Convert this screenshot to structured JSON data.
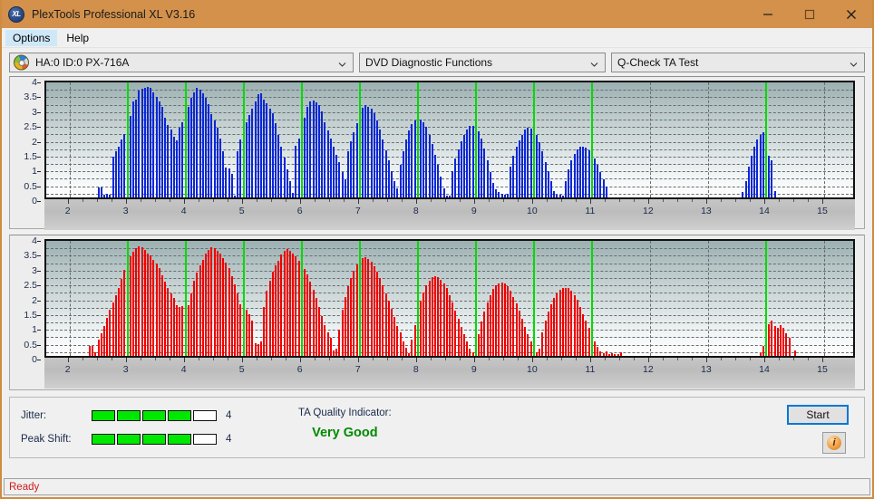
{
  "window": {
    "title": "PlexTools Professional XL V3.16",
    "app_icon": "xl-disc-icon",
    "minimize_label": "Minimize",
    "maximize_label": "Maximize",
    "close_label": "Close",
    "titlebar_color": "#d3914b"
  },
  "menu": {
    "items": [
      {
        "label": "Options"
      },
      {
        "label": "Help"
      }
    ]
  },
  "selectors": {
    "drive": {
      "value": "HA:0 ID:0  PX-716A",
      "icon": "disc-icon"
    },
    "function": {
      "value": "DVD Diagnostic Functions"
    },
    "test": {
      "value": "Q-Check TA Test"
    }
  },
  "status": {
    "text": "Ready",
    "color": "#d11a1a"
  },
  "metrics": {
    "jitter": {
      "label": "Jitter:",
      "value": "4",
      "filled": 4,
      "total": 5
    },
    "peak_shift": {
      "label": "Peak Shift:",
      "value": "4",
      "filled": 4,
      "total": 5
    },
    "ta_quality": {
      "label": "TA Quality Indicator:",
      "value": "Very Good",
      "color": "#008a00"
    }
  },
  "buttons": {
    "start": {
      "label": "Start"
    },
    "info": {
      "label": "i",
      "icon": "info-icon"
    }
  },
  "chart_data": [
    {
      "type": "bar",
      "id": "jitter-chart",
      "title": "",
      "xlabel": "",
      "ylabel": "",
      "series_name": "Jitter",
      "color": "#0b27d6",
      "xlim": [
        1.6,
        15.5
      ],
      "ylim": [
        0,
        4
      ],
      "yticks": [
        0,
        0.5,
        1,
        1.5,
        2,
        2.5,
        3,
        3.5,
        4
      ],
      "ytick_labels": [
        "0",
        "0.5",
        "1",
        "1.5",
        "2",
        "2.5",
        "3",
        "3.5",
        "4"
      ],
      "xticks": [
        2,
        3,
        4,
        5,
        6,
        7,
        8,
        9,
        10,
        11,
        12,
        13,
        14,
        15
      ],
      "xtick_labels": [
        "2",
        "3",
        "4",
        "5",
        "6",
        "7",
        "8",
        "9",
        "10",
        "11",
        "12",
        "13",
        "14",
        "15"
      ],
      "grid": true,
      "marker_lines": [
        3,
        4,
        5,
        6,
        7,
        8,
        9,
        10,
        11,
        14
      ],
      "x": [
        2.5,
        2.55,
        2.6,
        2.65,
        2.7,
        2.75,
        2.8,
        2.85,
        2.9,
        2.95,
        3.0,
        3.05,
        3.1,
        3.15,
        3.2,
        3.25,
        3.3,
        3.35,
        3.4,
        3.45,
        3.5,
        3.55,
        3.6,
        3.65,
        3.7,
        3.75,
        3.8,
        3.85,
        3.9,
        3.95,
        4.0,
        4.05,
        4.1,
        4.15,
        4.2,
        4.25,
        4.3,
        4.35,
        4.4,
        4.45,
        4.5,
        4.55,
        4.6,
        4.65,
        4.7,
        4.75,
        4.8,
        4.85,
        4.9,
        4.95,
        5.0,
        5.05,
        5.1,
        5.15,
        5.2,
        5.25,
        5.3,
        5.35,
        5.4,
        5.45,
        5.5,
        5.55,
        5.6,
        5.65,
        5.7,
        5.75,
        5.8,
        5.85,
        5.9,
        5.95,
        6.0,
        6.05,
        6.1,
        6.15,
        6.2,
        6.25,
        6.3,
        6.35,
        6.4,
        6.45,
        6.5,
        6.55,
        6.6,
        6.65,
        6.7,
        6.75,
        6.8,
        6.85,
        6.9,
        6.95,
        7.0,
        7.05,
        7.1,
        7.15,
        7.2,
        7.25,
        7.3,
        7.35,
        7.4,
        7.45,
        7.5,
        7.55,
        7.6,
        7.65,
        7.7,
        7.75,
        7.8,
        7.85,
        7.9,
        7.95,
        8.0,
        8.05,
        8.1,
        8.15,
        8.2,
        8.25,
        8.3,
        8.35,
        8.4,
        8.45,
        8.5,
        8.55,
        8.6,
        8.65,
        8.7,
        8.75,
        8.8,
        8.85,
        8.9,
        8.95,
        9.0,
        9.05,
        9.1,
        9.15,
        9.2,
        9.25,
        9.3,
        9.35,
        9.4,
        9.45,
        9.5,
        9.55,
        9.6,
        9.65,
        9.7,
        9.75,
        9.8,
        9.85,
        9.9,
        9.95,
        10.0,
        10.05,
        10.1,
        10.15,
        10.2,
        10.25,
        10.3,
        10.35,
        10.4,
        10.45,
        10.5,
        10.55,
        10.6,
        10.65,
        10.7,
        10.75,
        10.8,
        10.85,
        10.9,
        10.95,
        11.0,
        11.05,
        11.1,
        11.15,
        11.2,
        11.25,
        13.6,
        13.65,
        13.7,
        13.75,
        13.8,
        13.85,
        13.9,
        13.95,
        14.0,
        14.05,
        14.1,
        14.15
      ],
      "values": [
        0.33,
        0.33,
        0.1,
        0.12,
        0.1,
        1.38,
        1.55,
        1.7,
        1.95,
        2.15,
        2.4,
        2.75,
        3.25,
        3.3,
        3.6,
        3.65,
        3.7,
        3.72,
        3.7,
        3.55,
        3.4,
        3.25,
        3.05,
        2.7,
        2.45,
        2.3,
        2.05,
        1.92,
        2.35,
        2.55,
        2.7,
        3.05,
        3.35,
        3.55,
        3.68,
        3.62,
        3.5,
        3.35,
        3.15,
        2.8,
        2.6,
        2.35,
        2.0,
        1.55,
        1.0,
        0.98,
        0.8,
        0.05,
        1.55,
        1.95,
        2.25,
        2.55,
        2.78,
        3.0,
        3.25,
        3.48,
        3.52,
        3.3,
        3.18,
        3.0,
        2.85,
        2.5,
        2.1,
        1.7,
        1.35,
        0.95,
        0.55,
        0.15,
        1.75,
        2.0,
        2.35,
        2.7,
        3.05,
        3.25,
        3.28,
        3.22,
        3.1,
        2.9,
        2.55,
        2.25,
        2.0,
        1.72,
        1.45,
        1.2,
        0.85,
        0.6,
        1.55,
        1.9,
        2.2,
        2.5,
        2.8,
        3.02,
        3.1,
        3.05,
        3.0,
        2.85,
        2.6,
        2.3,
        1.95,
        1.6,
        1.25,
        0.9,
        0.55,
        0.3,
        1.1,
        1.55,
        1.95,
        2.25,
        2.48,
        2.6,
        2.65,
        2.62,
        2.55,
        2.38,
        2.12,
        1.8,
        1.45,
        1.1,
        0.7,
        0.3,
        0.05,
        0.05,
        0.9,
        1.3,
        1.62,
        1.9,
        2.12,
        2.3,
        2.4,
        2.42,
        2.38,
        2.22,
        2.0,
        1.65,
        1.25,
        0.85,
        0.5,
        0.28,
        0.18,
        0.12,
        0.08,
        0.12,
        1.05,
        1.4,
        1.7,
        1.92,
        2.12,
        2.28,
        2.35,
        2.32,
        2.28,
        2.1,
        1.85,
        1.55,
        1.2,
        0.9,
        0.55,
        0.22,
        0.08,
        0.08,
        0.06,
        0.55,
        0.95,
        1.25,
        1.48,
        1.62,
        1.7,
        1.72,
        1.68,
        1.6,
        1.48,
        1.32,
        1.1,
        0.85,
        0.6,
        0.38,
        0.18,
        0.55,
        1.05,
        1.4,
        1.7,
        1.95,
        2.12,
        2.2,
        2.18,
        1.4,
        1.25,
        0.2
      ]
    },
    {
      "type": "bar",
      "id": "peak-shift-chart",
      "title": "",
      "xlabel": "",
      "ylabel": "",
      "series_name": "Peak Shift",
      "color": "#ef0000",
      "xlim": [
        1.6,
        15.5
      ],
      "ylim": [
        0,
        4
      ],
      "yticks": [
        0,
        0.5,
        1,
        1.5,
        2,
        2.5,
        3,
        3.5,
        4
      ],
      "ytick_labels": [
        "0",
        "0.5",
        "1",
        "1.5",
        "2",
        "2.5",
        "3",
        "3.5",
        "4"
      ],
      "xticks": [
        2,
        3,
        4,
        5,
        6,
        7,
        8,
        9,
        10,
        11,
        12,
        13,
        14,
        15
      ],
      "xtick_labels": [
        "2",
        "3",
        "4",
        "5",
        "6",
        "7",
        "8",
        "9",
        "10",
        "11",
        "12",
        "13",
        "14",
        "15"
      ],
      "grid": true,
      "marker_lines": [
        3,
        4,
        5,
        6,
        7,
        8,
        9,
        10,
        11,
        14
      ],
      "x": [
        2.35,
        2.4,
        2.45,
        2.5,
        2.55,
        2.6,
        2.65,
        2.7,
        2.75,
        2.8,
        2.85,
        2.9,
        2.95,
        3.0,
        3.05,
        3.1,
        3.15,
        3.2,
        3.25,
        3.3,
        3.35,
        3.4,
        3.45,
        3.5,
        3.55,
        3.6,
        3.65,
        3.7,
        3.75,
        3.8,
        3.85,
        3.9,
        3.95,
        4.0,
        4.05,
        4.1,
        4.15,
        4.2,
        4.25,
        4.3,
        4.35,
        4.4,
        4.45,
        4.5,
        4.55,
        4.6,
        4.65,
        4.7,
        4.75,
        4.8,
        4.85,
        4.9,
        4.95,
        5.0,
        5.05,
        5.1,
        5.15,
        5.2,
        5.25,
        5.3,
        5.35,
        5.4,
        5.45,
        5.5,
        5.55,
        5.6,
        5.65,
        5.7,
        5.75,
        5.8,
        5.85,
        5.9,
        5.95,
        6.0,
        6.05,
        6.1,
        6.15,
        6.2,
        6.25,
        6.3,
        6.35,
        6.4,
        6.45,
        6.5,
        6.55,
        6.6,
        6.65,
        6.7,
        6.75,
        6.8,
        6.85,
        6.9,
        6.95,
        7.0,
        7.05,
        7.1,
        7.15,
        7.2,
        7.25,
        7.3,
        7.35,
        7.4,
        7.45,
        7.5,
        7.55,
        7.6,
        7.65,
        7.7,
        7.75,
        7.8,
        7.85,
        7.9,
        7.95,
        8.0,
        8.05,
        8.1,
        8.15,
        8.2,
        8.25,
        8.3,
        8.35,
        8.4,
        8.45,
        8.5,
        8.55,
        8.6,
        8.65,
        8.7,
        8.75,
        8.8,
        8.85,
        8.9,
        8.95,
        9.0,
        9.05,
        9.1,
        9.15,
        9.2,
        9.25,
        9.3,
        9.35,
        9.4,
        9.45,
        9.5,
        9.55,
        9.6,
        9.65,
        9.7,
        9.75,
        9.8,
        9.85,
        9.9,
        9.95,
        10.0,
        10.05,
        10.1,
        10.15,
        10.2,
        10.25,
        10.3,
        10.35,
        10.4,
        10.45,
        10.5,
        10.55,
        10.6,
        10.65,
        10.7,
        10.75,
        10.8,
        10.85,
        10.9,
        10.95,
        11.0,
        11.05,
        11.1,
        11.15,
        11.2,
        11.25,
        11.3,
        11.35,
        11.4,
        11.45,
        11.5,
        13.9,
        13.95,
        14.0,
        14.05,
        14.1,
        14.15,
        14.2,
        14.25,
        14.3,
        14.35,
        14.4,
        14.5
      ],
      "values": [
        0.35,
        0.35,
        0.12,
        0.55,
        0.75,
        1.0,
        1.28,
        1.55,
        1.8,
        2.05,
        2.3,
        2.6,
        2.9,
        3.15,
        3.35,
        3.5,
        3.62,
        3.68,
        3.65,
        3.58,
        3.45,
        3.38,
        3.25,
        3.12,
        2.95,
        2.72,
        2.5,
        2.3,
        2.12,
        1.95,
        1.7,
        1.65,
        1.68,
        1.7,
        1.72,
        2.1,
        2.55,
        2.8,
        3.05,
        3.25,
        3.45,
        3.58,
        3.65,
        3.62,
        3.55,
        3.45,
        3.3,
        3.15,
        2.95,
        2.7,
        2.4,
        2.1,
        1.75,
        1.65,
        1.55,
        1.42,
        1.18,
        0.42,
        0.4,
        0.5,
        1.65,
        2.2,
        2.55,
        2.85,
        3.05,
        3.22,
        3.42,
        3.55,
        3.6,
        3.55,
        3.45,
        3.35,
        3.22,
        3.08,
        2.92,
        2.75,
        2.5,
        2.22,
        1.95,
        1.65,
        1.35,
        1.05,
        0.8,
        0.6,
        0.18,
        0.25,
        0.9,
        1.55,
        2.0,
        2.35,
        2.62,
        2.88,
        3.08,
        3.22,
        3.3,
        3.32,
        3.28,
        3.18,
        3.02,
        2.85,
        2.62,
        2.38,
        2.12,
        1.85,
        1.58,
        1.3,
        1.02,
        0.78,
        0.5,
        0.28,
        0.1,
        0.55,
        1.05,
        1.5,
        1.85,
        2.15,
        2.38,
        2.55,
        2.65,
        2.68,
        2.65,
        2.58,
        2.45,
        2.28,
        2.05,
        1.8,
        1.52,
        1.25,
        0.98,
        0.72,
        0.48,
        0.25,
        0.12,
        0.18,
        0.72,
        1.15,
        1.5,
        1.8,
        2.05,
        2.25,
        2.38,
        2.45,
        2.48,
        2.45,
        2.35,
        2.2,
        2.0,
        1.78,
        1.52,
        1.25,
        0.98,
        0.72,
        0.48,
        0.28,
        0.12,
        0.25,
        0.8,
        1.2,
        1.5,
        1.75,
        1.95,
        2.12,
        2.22,
        2.28,
        2.3,
        2.28,
        2.2,
        2.05,
        1.88,
        1.65,
        1.42,
        1.18,
        0.95,
        0.72,
        0.5,
        0.3,
        0.15,
        0.08,
        0.15,
        0.05,
        0.08,
        0.05,
        0.05,
        0.12,
        0.1,
        0.35,
        0.72,
        1.08,
        1.2,
        1.0,
        0.95,
        1.05,
        0.95,
        0.75,
        0.62,
        0.18
      ]
    }
  ]
}
